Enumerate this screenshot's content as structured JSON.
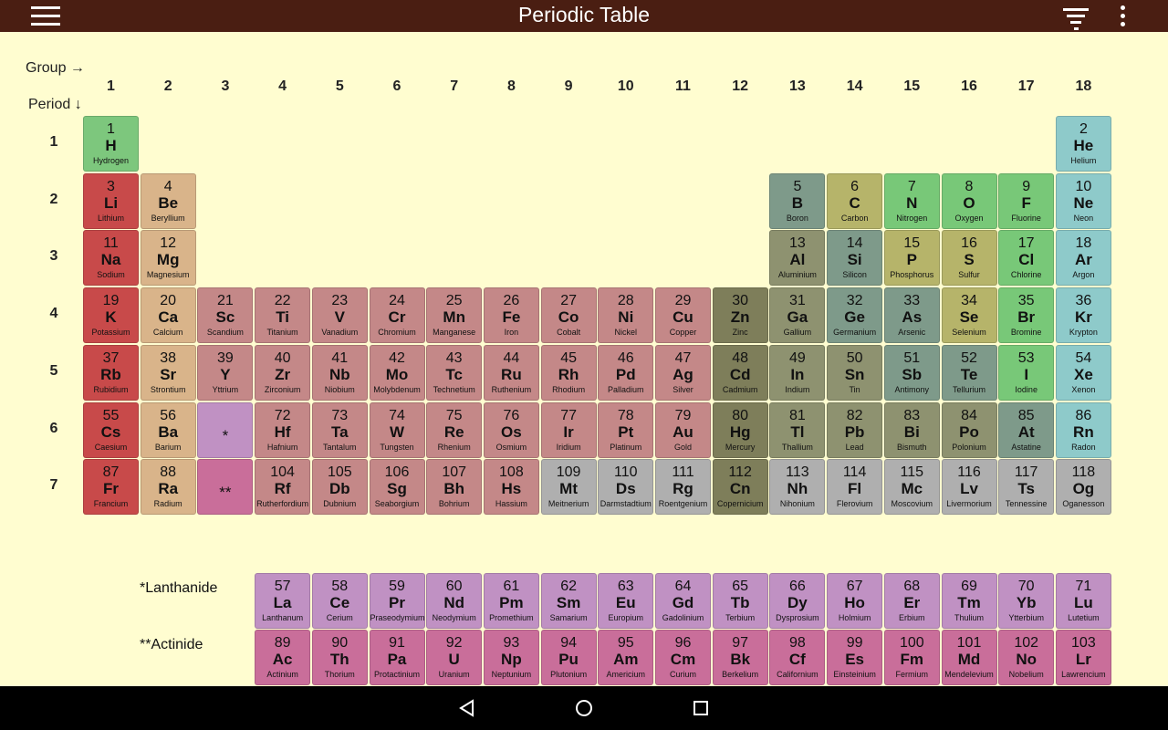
{
  "app": {
    "title": "Periodic Table"
  },
  "header": {
    "menu_icon": "hamburger-menu-icon",
    "filter_icon": "filter-icon",
    "more_icon": "more-vert-icon"
  },
  "axis": {
    "group_label": "Group →",
    "period_label": "Period ↓"
  },
  "groups": [
    "1",
    "2",
    "3",
    "4",
    "5",
    "6",
    "7",
    "8",
    "9",
    "10",
    "11",
    "12",
    "13",
    "14",
    "15",
    "16",
    "17",
    "18"
  ],
  "periods": [
    "1",
    "2",
    "3",
    "4",
    "5",
    "6",
    "7"
  ],
  "colors": {
    "alkali": "#C84A4A",
    "alkaline": "#D9B48A",
    "transition": "#C48888",
    "post": "#8E9270",
    "metalloid": "#7E9A8A",
    "nonmetal": "#B6B46A",
    "halogen": "#78C878",
    "noble": "#8ECACA",
    "hydrogen": "#7DC77D",
    "unknown": "#AFAFAF",
    "lanthanide": "#C091C3",
    "actinide": "#C96E9A",
    "zinc": "#7E7E5A",
    "header_bg": "#4A1E12",
    "page_bg": "#FFFDD0"
  },
  "elements": [
    {
      "n": "1",
      "s": "H",
      "name": "Hydrogen",
      "g": 1,
      "p": 1,
      "c": "hydrogen"
    },
    {
      "n": "2",
      "s": "He",
      "name": "Helium",
      "g": 18,
      "p": 1,
      "c": "noble"
    },
    {
      "n": "3",
      "s": "Li",
      "name": "Lithium",
      "g": 1,
      "p": 2,
      "c": "alkali"
    },
    {
      "n": "4",
      "s": "Be",
      "name": "Beryllium",
      "g": 2,
      "p": 2,
      "c": "alkaline"
    },
    {
      "n": "5",
      "s": "B",
      "name": "Boron",
      "g": 13,
      "p": 2,
      "c": "metalloid"
    },
    {
      "n": "6",
      "s": "C",
      "name": "Carbon",
      "g": 14,
      "p": 2,
      "c": "nonmetal"
    },
    {
      "n": "7",
      "s": "N",
      "name": "Nitrogen",
      "g": 15,
      "p": 2,
      "c": "halogen"
    },
    {
      "n": "8",
      "s": "O",
      "name": "Oxygen",
      "g": 16,
      "p": 2,
      "c": "halogen"
    },
    {
      "n": "9",
      "s": "F",
      "name": "Fluorine",
      "g": 17,
      "p": 2,
      "c": "halogen"
    },
    {
      "n": "10",
      "s": "Ne",
      "name": "Neon",
      "g": 18,
      "p": 2,
      "c": "noble"
    },
    {
      "n": "11",
      "s": "Na",
      "name": "Sodium",
      "g": 1,
      "p": 3,
      "c": "alkali"
    },
    {
      "n": "12",
      "s": "Mg",
      "name": "Magnesium",
      "g": 2,
      "p": 3,
      "c": "alkaline"
    },
    {
      "n": "13",
      "s": "Al",
      "name": "Aluminium",
      "g": 13,
      "p": 3,
      "c": "post"
    },
    {
      "n": "14",
      "s": "Si",
      "name": "Silicon",
      "g": 14,
      "p": 3,
      "c": "metalloid"
    },
    {
      "n": "15",
      "s": "P",
      "name": "Phosphorus",
      "g": 15,
      "p": 3,
      "c": "nonmetal"
    },
    {
      "n": "16",
      "s": "S",
      "name": "Sulfur",
      "g": 16,
      "p": 3,
      "c": "nonmetal"
    },
    {
      "n": "17",
      "s": "Cl",
      "name": "Chlorine",
      "g": 17,
      "p": 3,
      "c": "halogen"
    },
    {
      "n": "18",
      "s": "Ar",
      "name": "Argon",
      "g": 18,
      "p": 3,
      "c": "noble"
    },
    {
      "n": "19",
      "s": "K",
      "name": "Potassium",
      "g": 1,
      "p": 4,
      "c": "alkali"
    },
    {
      "n": "20",
      "s": "Ca",
      "name": "Calcium",
      "g": 2,
      "p": 4,
      "c": "alkaline"
    },
    {
      "n": "21",
      "s": "Sc",
      "name": "Scandium",
      "g": 3,
      "p": 4,
      "c": "transition"
    },
    {
      "n": "22",
      "s": "Ti",
      "name": "Titanium",
      "g": 4,
      "p": 4,
      "c": "transition"
    },
    {
      "n": "23",
      "s": "V",
      "name": "Vanadium",
      "g": 5,
      "p": 4,
      "c": "transition"
    },
    {
      "n": "24",
      "s": "Cr",
      "name": "Chromium",
      "g": 6,
      "p": 4,
      "c": "transition"
    },
    {
      "n": "25",
      "s": "Mn",
      "name": "Manganese",
      "g": 7,
      "p": 4,
      "c": "transition"
    },
    {
      "n": "26",
      "s": "Fe",
      "name": "Iron",
      "g": 8,
      "p": 4,
      "c": "transition"
    },
    {
      "n": "27",
      "s": "Co",
      "name": "Cobalt",
      "g": 9,
      "p": 4,
      "c": "transition"
    },
    {
      "n": "28",
      "s": "Ni",
      "name": "Nickel",
      "g": 10,
      "p": 4,
      "c": "transition"
    },
    {
      "n": "29",
      "s": "Cu",
      "name": "Copper",
      "g": 11,
      "p": 4,
      "c": "transition"
    },
    {
      "n": "30",
      "s": "Zn",
      "name": "Zinc",
      "g": 12,
      "p": 4,
      "c": "zinc"
    },
    {
      "n": "31",
      "s": "Ga",
      "name": "Gallium",
      "g": 13,
      "p": 4,
      "c": "post"
    },
    {
      "n": "32",
      "s": "Ge",
      "name": "Germanium",
      "g": 14,
      "p": 4,
      "c": "metalloid"
    },
    {
      "n": "33",
      "s": "As",
      "name": "Arsenic",
      "g": 15,
      "p": 4,
      "c": "metalloid"
    },
    {
      "n": "34",
      "s": "Se",
      "name": "Selenium",
      "g": 16,
      "p": 4,
      "c": "nonmetal"
    },
    {
      "n": "35",
      "s": "Br",
      "name": "Bromine",
      "g": 17,
      "p": 4,
      "c": "halogen"
    },
    {
      "n": "36",
      "s": "Kr",
      "name": "Krypton",
      "g": 18,
      "p": 4,
      "c": "noble"
    },
    {
      "n": "37",
      "s": "Rb",
      "name": "Rubidium",
      "g": 1,
      "p": 5,
      "c": "alkali"
    },
    {
      "n": "38",
      "s": "Sr",
      "name": "Strontium",
      "g": 2,
      "p": 5,
      "c": "alkaline"
    },
    {
      "n": "39",
      "s": "Y",
      "name": "Yttrium",
      "g": 3,
      "p": 5,
      "c": "transition"
    },
    {
      "n": "40",
      "s": "Zr",
      "name": "Zirconium",
      "g": 4,
      "p": 5,
      "c": "transition"
    },
    {
      "n": "41",
      "s": "Nb",
      "name": "Niobium",
      "g": 5,
      "p": 5,
      "c": "transition"
    },
    {
      "n": "42",
      "s": "Mo",
      "name": "Molybdenum",
      "g": 6,
      "p": 5,
      "c": "transition"
    },
    {
      "n": "43",
      "s": "Tc",
      "name": "Technetium",
      "g": 7,
      "p": 5,
      "c": "transition"
    },
    {
      "n": "44",
      "s": "Ru",
      "name": "Ruthenium",
      "g": 8,
      "p": 5,
      "c": "transition"
    },
    {
      "n": "45",
      "s": "Rh",
      "name": "Rhodium",
      "g": 9,
      "p": 5,
      "c": "transition"
    },
    {
      "n": "46",
      "s": "Pd",
      "name": "Palladium",
      "g": 10,
      "p": 5,
      "c": "transition"
    },
    {
      "n": "47",
      "s": "Ag",
      "name": "Silver",
      "g": 11,
      "p": 5,
      "c": "transition"
    },
    {
      "n": "48",
      "s": "Cd",
      "name": "Cadmium",
      "g": 12,
      "p": 5,
      "c": "zinc"
    },
    {
      "n": "49",
      "s": "In",
      "name": "Indium",
      "g": 13,
      "p": 5,
      "c": "post"
    },
    {
      "n": "50",
      "s": "Sn",
      "name": "Tin",
      "g": 14,
      "p": 5,
      "c": "post"
    },
    {
      "n": "51",
      "s": "Sb",
      "name": "Antimony",
      "g": 15,
      "p": 5,
      "c": "metalloid"
    },
    {
      "n": "52",
      "s": "Te",
      "name": "Tellurium",
      "g": 16,
      "p": 5,
      "c": "metalloid"
    },
    {
      "n": "53",
      "s": "I",
      "name": "Iodine",
      "g": 17,
      "p": 5,
      "c": "halogen"
    },
    {
      "n": "54",
      "s": "Xe",
      "name": "Xenon",
      "g": 18,
      "p": 5,
      "c": "noble"
    },
    {
      "n": "55",
      "s": "Cs",
      "name": "Caesium",
      "g": 1,
      "p": 6,
      "c": "alkali"
    },
    {
      "n": "56",
      "s": "Ba",
      "name": "Barium",
      "g": 2,
      "p": 6,
      "c": "alkaline"
    },
    {
      "n": "72",
      "s": "Hf",
      "name": "Hafnium",
      "g": 4,
      "p": 6,
      "c": "transition"
    },
    {
      "n": "73",
      "s": "Ta",
      "name": "Tantalum",
      "g": 5,
      "p": 6,
      "c": "transition"
    },
    {
      "n": "74",
      "s": "W",
      "name": "Tungsten",
      "g": 6,
      "p": 6,
      "c": "transition"
    },
    {
      "n": "75",
      "s": "Re",
      "name": "Rhenium",
      "g": 7,
      "p": 6,
      "c": "transition"
    },
    {
      "n": "76",
      "s": "Os",
      "name": "Osmium",
      "g": 8,
      "p": 6,
      "c": "transition"
    },
    {
      "n": "77",
      "s": "Ir",
      "name": "Iridium",
      "g": 9,
      "p": 6,
      "c": "transition"
    },
    {
      "n": "78",
      "s": "Pt",
      "name": "Platinum",
      "g": 10,
      "p": 6,
      "c": "transition"
    },
    {
      "n": "79",
      "s": "Au",
      "name": "Gold",
      "g": 11,
      "p": 6,
      "c": "transition"
    },
    {
      "n": "80",
      "s": "Hg",
      "name": "Mercury",
      "g": 12,
      "p": 6,
      "c": "zinc"
    },
    {
      "n": "81",
      "s": "Tl",
      "name": "Thallium",
      "g": 13,
      "p": 6,
      "c": "post"
    },
    {
      "n": "82",
      "s": "Pb",
      "name": "Lead",
      "g": 14,
      "p": 6,
      "c": "post"
    },
    {
      "n": "83",
      "s": "Bi",
      "name": "Bismuth",
      "g": 15,
      "p": 6,
      "c": "post"
    },
    {
      "n": "84",
      "s": "Po",
      "name": "Polonium",
      "g": 16,
      "p": 6,
      "c": "post"
    },
    {
      "n": "85",
      "s": "At",
      "name": "Astatine",
      "g": 17,
      "p": 6,
      "c": "metalloid"
    },
    {
      "n": "86",
      "s": "Rn",
      "name": "Radon",
      "g": 18,
      "p": 6,
      "c": "noble"
    },
    {
      "n": "87",
      "s": "Fr",
      "name": "Francium",
      "g": 1,
      "p": 7,
      "c": "alkali"
    },
    {
      "n": "88",
      "s": "Ra",
      "name": "Radium",
      "g": 2,
      "p": 7,
      "c": "alkaline"
    },
    {
      "n": "104",
      "s": "Rf",
      "name": "Rutherfordium",
      "g": 4,
      "p": 7,
      "c": "transition"
    },
    {
      "n": "105",
      "s": "Db",
      "name": "Dubnium",
      "g": 5,
      "p": 7,
      "c": "transition"
    },
    {
      "n": "106",
      "s": "Sg",
      "name": "Seaborgium",
      "g": 6,
      "p": 7,
      "c": "transition"
    },
    {
      "n": "107",
      "s": "Bh",
      "name": "Bohrium",
      "g": 7,
      "p": 7,
      "c": "transition"
    },
    {
      "n": "108",
      "s": "Hs",
      "name": "Hassium",
      "g": 8,
      "p": 7,
      "c": "transition"
    },
    {
      "n": "109",
      "s": "Mt",
      "name": "Meitnerium",
      "g": 9,
      "p": 7,
      "c": "unknown"
    },
    {
      "n": "110",
      "s": "Ds",
      "name": "Darmstadtium",
      "g": 10,
      "p": 7,
      "c": "unknown"
    },
    {
      "n": "111",
      "s": "Rg",
      "name": "Roentgenium",
      "g": 11,
      "p": 7,
      "c": "unknown"
    },
    {
      "n": "112",
      "s": "Cn",
      "name": "Copernicium",
      "g": 12,
      "p": 7,
      "c": "zinc"
    },
    {
      "n": "113",
      "s": "Nh",
      "name": "Nihonium",
      "g": 13,
      "p": 7,
      "c": "unknown"
    },
    {
      "n": "114",
      "s": "Fl",
      "name": "Flerovium",
      "g": 14,
      "p": 7,
      "c": "unknown"
    },
    {
      "n": "115",
      "s": "Mc",
      "name": "Moscovium",
      "g": 15,
      "p": 7,
      "c": "unknown"
    },
    {
      "n": "116",
      "s": "Lv",
      "name": "Livermorium",
      "g": 16,
      "p": 7,
      "c": "unknown"
    },
    {
      "n": "117",
      "s": "Ts",
      "name": "Tennessine",
      "g": 17,
      "p": 7,
      "c": "unknown"
    },
    {
      "n": "118",
      "s": "Og",
      "name": "Oganesson",
      "g": 18,
      "p": 7,
      "c": "unknown"
    }
  ],
  "placeholders": [
    {
      "mark": "*",
      "g": 3,
      "p": 6,
      "c": "lanthanide"
    },
    {
      "mark": "**",
      "g": 3,
      "p": 7,
      "c": "actinide"
    }
  ],
  "series": {
    "lanthanide_label": "*Lanthanide",
    "actinide_label": "**Actinide",
    "lanthanides": [
      {
        "n": "57",
        "s": "La",
        "name": "Lanthanum"
      },
      {
        "n": "58",
        "s": "Ce",
        "name": "Cerium"
      },
      {
        "n": "59",
        "s": "Pr",
        "name": "Praseodymium"
      },
      {
        "n": "60",
        "s": "Nd",
        "name": "Neodymium"
      },
      {
        "n": "61",
        "s": "Pm",
        "name": "Promethium"
      },
      {
        "n": "62",
        "s": "Sm",
        "name": "Samarium"
      },
      {
        "n": "63",
        "s": "Eu",
        "name": "Europium"
      },
      {
        "n": "64",
        "s": "Gd",
        "name": "Gadolinium"
      },
      {
        "n": "65",
        "s": "Tb",
        "name": "Terbium"
      },
      {
        "n": "66",
        "s": "Dy",
        "name": "Dysprosium"
      },
      {
        "n": "67",
        "s": "Ho",
        "name": "Holmium"
      },
      {
        "n": "68",
        "s": "Er",
        "name": "Erbium"
      },
      {
        "n": "69",
        "s": "Tm",
        "name": "Thulium"
      },
      {
        "n": "70",
        "s": "Yb",
        "name": "Ytterbium"
      },
      {
        "n": "71",
        "s": "Lu",
        "name": "Lutetium"
      }
    ],
    "actinides": [
      {
        "n": "89",
        "s": "Ac",
        "name": "Actinium"
      },
      {
        "n": "90",
        "s": "Th",
        "name": "Thorium"
      },
      {
        "n": "91",
        "s": "Pa",
        "name": "Protactinium"
      },
      {
        "n": "92",
        "s": "U",
        "name": "Uranium"
      },
      {
        "n": "93",
        "s": "Np",
        "name": "Neptunium"
      },
      {
        "n": "94",
        "s": "Pu",
        "name": "Plutonium"
      },
      {
        "n": "95",
        "s": "Am",
        "name": "Americium"
      },
      {
        "n": "96",
        "s": "Cm",
        "name": "Curium"
      },
      {
        "n": "97",
        "s": "Bk",
        "name": "Berkelium"
      },
      {
        "n": "98",
        "s": "Cf",
        "name": "Californium"
      },
      {
        "n": "99",
        "s": "Es",
        "name": "Einsteinium"
      },
      {
        "n": "100",
        "s": "Fm",
        "name": "Fermium"
      },
      {
        "n": "101",
        "s": "Md",
        "name": "Mendelevium"
      },
      {
        "n": "102",
        "s": "No",
        "name": "Nobelium"
      },
      {
        "n": "103",
        "s": "Lr",
        "name": "Lawrencium"
      }
    ]
  },
  "navbar": {
    "back_icon": "back-triangle-icon",
    "home_icon": "home-circle-icon",
    "recents_icon": "recents-square-icon"
  }
}
